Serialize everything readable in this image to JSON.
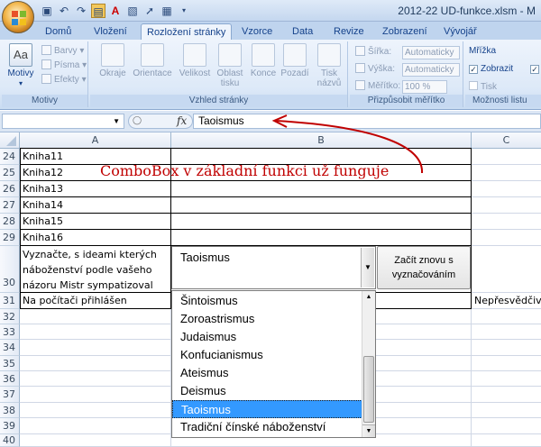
{
  "window": {
    "title": "2012-22 UD-funkce.xlsm - M"
  },
  "ribbon": {
    "tabs": [
      {
        "label": "Domů"
      },
      {
        "label": "Vložení"
      },
      {
        "label": "Rozložení stránky"
      },
      {
        "label": "Vzorce"
      },
      {
        "label": "Data"
      },
      {
        "label": "Revize"
      },
      {
        "label": "Zobrazení"
      },
      {
        "label": "Vývojář"
      }
    ],
    "active_tab": "Rozložení stránky",
    "groups": {
      "motivy": {
        "label": "Motivy",
        "motivy_button": "Motivy",
        "barvy": "Barvy",
        "pisma": "Písma",
        "efekty": "Efekty"
      },
      "vzhled": {
        "label": "Vzhled stránky",
        "buttons": [
          "Okraje",
          "Orientace",
          "Velikost",
          "Oblast tisku",
          "Konce",
          "Pozadí",
          "Tisk názvů"
        ]
      },
      "meritko": {
        "label": "Přizpůsobit měřítko",
        "sirka_label": "Šířka:",
        "sirka_value": "Automaticky",
        "vyska_label": "Výška:",
        "vyska_value": "Automaticky",
        "meritko_label": "Měřítko:",
        "meritko_value": "100 %"
      },
      "moznosti": {
        "label": "Možnosti listu",
        "mrizka_label": "Mřížka",
        "zobrazit_label": "Zobrazit",
        "tisk_label": "Tisk",
        "zobrazit_checked": true,
        "tisk_checked": false
      }
    }
  },
  "formula_bar": {
    "name_box": "",
    "fx": "fx",
    "formula": "Taoismus"
  },
  "sheet": {
    "columns": [
      "A",
      "B",
      "C"
    ],
    "rows": [
      {
        "num": "24",
        "a": "Kniha11",
        "b": "",
        "c": ""
      },
      {
        "num": "25",
        "a": "Kniha12",
        "b": "",
        "c": ""
      },
      {
        "num": "26",
        "a": "Kniha13",
        "b": "",
        "c": ""
      },
      {
        "num": "27",
        "a": "Kniha14",
        "b": "",
        "c": ""
      },
      {
        "num": "28",
        "a": "Kniha15",
        "b": "",
        "c": ""
      },
      {
        "num": "29",
        "a": "Kniha16",
        "b": "",
        "c": ""
      },
      {
        "num": "30",
        "a_lines": [
          "Vyznačte, s ideami kterých",
          "náboženství podle vašeho",
          "názoru Mistr sympatizoval"
        ],
        "b": "",
        "c": ""
      },
      {
        "num": "31",
        "a": "Na počítači přihlášen",
        "b": "",
        "c": "Nepřesvědčiv"
      },
      {
        "num": "32",
        "a": "",
        "b": "",
        "c": ""
      },
      {
        "num": "33",
        "a": "",
        "b": "",
        "c": ""
      },
      {
        "num": "34",
        "a": "",
        "b": "",
        "c": ""
      },
      {
        "num": "35",
        "a": "",
        "b": "",
        "c": ""
      },
      {
        "num": "36",
        "a": "",
        "b": "",
        "c": ""
      },
      {
        "num": "37",
        "a": "",
        "b": "",
        "c": ""
      },
      {
        "num": "38",
        "a": "",
        "b": "",
        "c": ""
      },
      {
        "num": "39",
        "a": "",
        "b": "",
        "c": ""
      },
      {
        "num": "40",
        "a": "",
        "b": "",
        "c": ""
      }
    ]
  },
  "combobox": {
    "value": "Taoismus",
    "options": [
      "Šintoismus",
      "Zoroastrismus",
      "Judaismus",
      "Konfucianismus",
      "Ateismus",
      "Deismus",
      "Taoismus",
      "Tradiční čínské náboženství"
    ],
    "selected": "Taoismus"
  },
  "restart_button": {
    "line1": "Začít znovu s",
    "line2": "vyznačováním"
  },
  "annotation": {
    "text": "ComboBox v základní funkci už funguje",
    "color": "#c00000"
  },
  "colors": {
    "ribbon_accent": "#15428b",
    "selection": "#3399ff",
    "annotation": "#c00000"
  }
}
